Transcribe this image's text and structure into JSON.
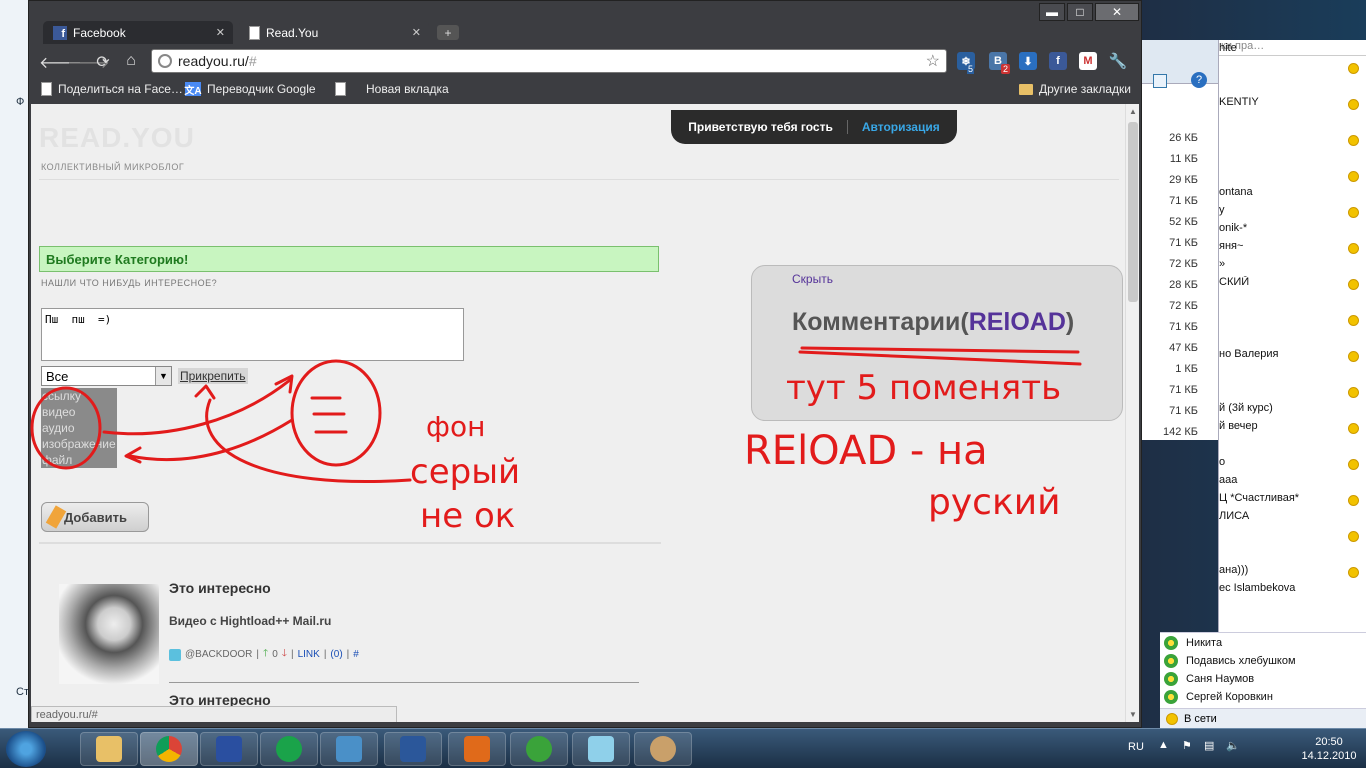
{
  "browser": {
    "tabs": [
      {
        "label": "Facebook",
        "icon": "facebook-icon"
      },
      {
        "label": "Read.You",
        "icon": "page-icon"
      }
    ],
    "url": {
      "host": "readyou.ru/",
      "path": "#"
    },
    "extension_badges": {
      "weather": "5",
      "vk": "2"
    },
    "bookmarks": [
      {
        "label": "Поделиться на Face…"
      },
      {
        "label": "Переводчик Google"
      },
      {
        "label": "Новая вкладка"
      }
    ],
    "other_bookmarks": "Другие закладки",
    "status_url": "readyou.ru/#"
  },
  "site": {
    "logo": "READ.YOU",
    "tagline": "КОЛЛЕКТИВНЫЙ МИКРОБЛОГ",
    "greeting": "Приветствую тебя гость",
    "login": "Авторизация",
    "category_prompt": "Выберите Категорию!",
    "sub_prompt": "НАШЛИ ЧТО НИБУДЬ ИНТЕРЕСНОЕ?",
    "post_text": "Пш  пш  =)",
    "select_value": "Все",
    "attach_label": "Прикрепить",
    "type_options": [
      "ссылку",
      "видео",
      "аудио",
      "изображение",
      "файл"
    ],
    "add_label": "Добавить",
    "feed": [
      {
        "title": "Это интересно",
        "subtitle": "Видео с Hightload++ Mail.ru",
        "author": "@BACKDOOR",
        "votes": "0",
        "link_label": "LINK",
        "comments": "(0)",
        "hash": "#"
      },
      {
        "title": "Это интересно"
      }
    ],
    "comments": {
      "hide": "Скрыть",
      "title": "Комментарии(",
      "reload": "RElOAD",
      "close": ")"
    }
  },
  "annotations": {
    "font_note": [
      "фон",
      "серый",
      "не ок"
    ],
    "here_move": "тут 5 поменять",
    "reload_note": [
      "RElOAD - на",
      "руский"
    ]
  },
  "file_panel": {
    "sizes": [
      "26 КБ",
      "11 КБ",
      "29 КБ",
      "71 КБ",
      "52 КБ",
      "71 КБ",
      "72 КБ",
      "28 КБ",
      "72 КБ",
      "71 КБ",
      "47 КБ",
      "1 КБ",
      "71 КБ",
      "71 КБ",
      "142 КБ"
    ]
  },
  "icq": {
    "search_placeholder": "ки пра…",
    "items": [
      "hite",
      "",
      "",
      "KENTIY",
      "",
      "",
      "",
      "",
      "ontana",
      "y",
      "onik-*",
      "яня~",
      "»",
      "СКИЙ",
      "",
      "",
      "",
      "но Валерия",
      "",
      "",
      "й (3й курс)",
      "й вечер",
      "",
      "о",
      "aaa",
      "Ц *Счастливая*",
      "ЛИСА",
      "",
      "",
      "ана)))",
      "ec Islambekova"
    ],
    "contacts": [
      "Никита",
      "Подавись хлебушком",
      "Саня Наумов",
      "Сергей Коровкин"
    ],
    "status": "В сети"
  },
  "taskbar": {
    "language": "RU",
    "time": "20:50",
    "date": "14.12.2010"
  },
  "colors": {
    "category_bg": "#c8f5c0",
    "login_link": "#39a7e6",
    "reload": "#553399",
    "annotation": "#e21b1b"
  }
}
